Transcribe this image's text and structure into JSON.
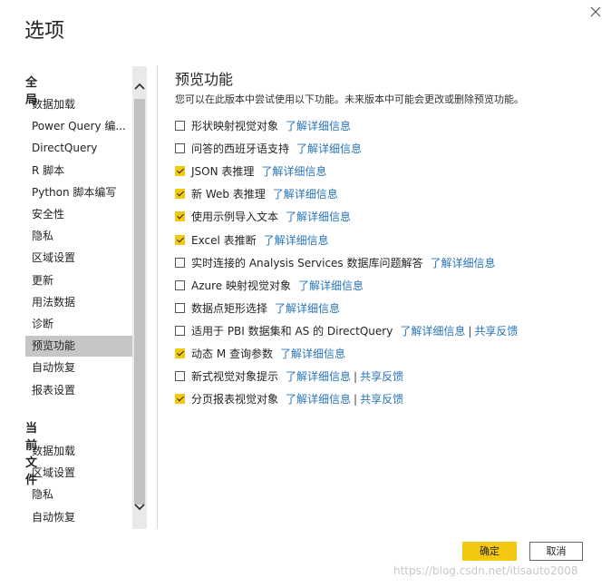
{
  "dialog": {
    "title": "选项",
    "close_icon": "close-icon"
  },
  "sidebar": {
    "global_header": "全局",
    "global_items": [
      {
        "label": "数据加载"
      },
      {
        "label": "Power Query 编..."
      },
      {
        "label": "DirectQuery"
      },
      {
        "label": "R 脚本"
      },
      {
        "label": "Python 脚本编写"
      },
      {
        "label": "安全性"
      },
      {
        "label": "隐私"
      },
      {
        "label": "区域设置"
      },
      {
        "label": "更新"
      },
      {
        "label": "用法数据"
      },
      {
        "label": "诊断"
      },
      {
        "label": "预览功能",
        "selected": true
      },
      {
        "label": "自动恢复"
      },
      {
        "label": "报表设置"
      }
    ],
    "file_header": "当前文件",
    "file_items": [
      {
        "label": "数据加载"
      },
      {
        "label": "区域设置"
      },
      {
        "label": "隐私"
      },
      {
        "label": "自动恢复"
      }
    ]
  },
  "main": {
    "heading": "预览功能",
    "description": "您可以在此版本中尝试使用以下功能。未来版本中可能会更改或删除预览功能。",
    "features": [
      {
        "label": "形状映射视觉对象",
        "checked": false,
        "link": "了解详细信息"
      },
      {
        "label": "问答的西班牙语支持",
        "checked": false,
        "link": "了解详细信息"
      },
      {
        "label": "JSON 表推理",
        "checked": true,
        "link": "了解详细信息"
      },
      {
        "label": "新 Web 表推理",
        "checked": true,
        "link": "了解详细信息"
      },
      {
        "label": "使用示例导入文本",
        "checked": true,
        "link": "了解详细信息"
      },
      {
        "label": "Excel 表推断",
        "checked": true,
        "link": "了解详细信息"
      },
      {
        "label": "实时连接的 Analysis Services 数据库问题解答",
        "checked": false,
        "link": "了解详细信息"
      },
      {
        "label": "Azure 映射视觉对象",
        "checked": false,
        "link": "了解详细信息"
      },
      {
        "label": "数据点矩形选择",
        "checked": false,
        "link": "了解详细信息"
      },
      {
        "label": "适用于 PBI 数据集和 AS 的 DirectQuery",
        "checked": false,
        "link": "了解详细信息",
        "separator": "|",
        "link2": "共享反馈"
      },
      {
        "label": "动态 M 查询参数",
        "checked": true,
        "link": "了解详细信息"
      },
      {
        "label": "新式视觉对象提示",
        "checked": false,
        "link": "了解详细信息",
        "separator": "|",
        "link2": "共享反馈"
      },
      {
        "label": "分页报表视觉对象",
        "checked": true,
        "link": "了解详细信息",
        "separator": "|",
        "link2": "共享反馈"
      }
    ]
  },
  "footer": {
    "ok_label": "确定",
    "cancel_label": "取消"
  },
  "watermark": "https://blog.csdn.net/itisauto2008",
  "colors": {
    "accent": "#f2c811",
    "link": "#2874b8",
    "selected_bg": "#c8c6c4"
  }
}
